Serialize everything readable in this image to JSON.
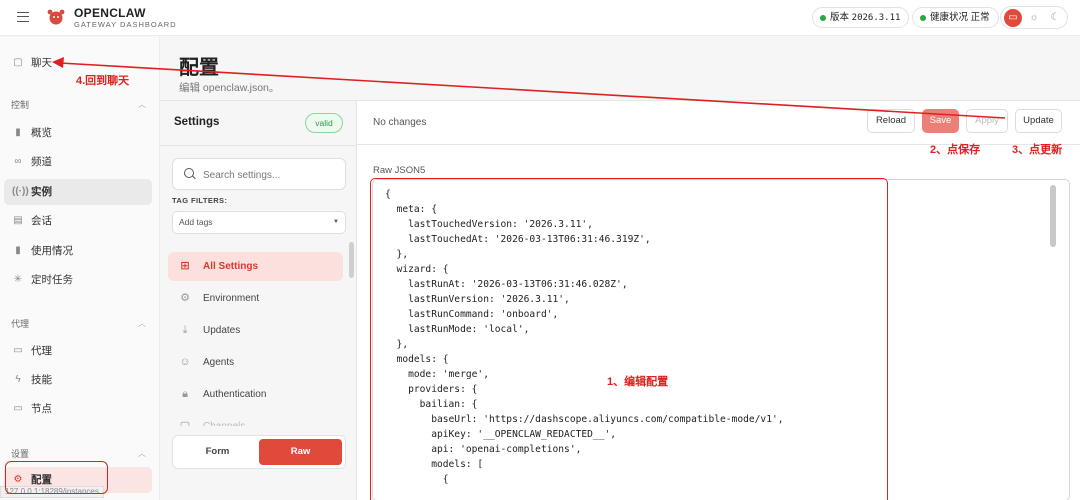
{
  "header": {
    "brand_title": "OPENCLAW",
    "brand_subtitle": "GATEWAY DASHBOARD",
    "version_label": "版本",
    "version_value": "2026.3.11",
    "health_label": "健康状况",
    "health_value": "正常"
  },
  "sidebar": {
    "chat": {
      "label": "聊天",
      "icon": "chat-bubble-icon"
    },
    "sections": [
      {
        "title": "控制",
        "items": [
          {
            "label": "概览",
            "icon": "bar-chart-icon"
          },
          {
            "label": "频道",
            "icon": "link-icon"
          },
          {
            "label": "实例",
            "icon": "broadcast-icon"
          },
          {
            "label": "会话",
            "icon": "document-icon"
          },
          {
            "label": "使用情况",
            "icon": "bar-chart-icon"
          },
          {
            "label": "定时任务",
            "icon": "loader-icon"
          }
        ]
      },
      {
        "title": "代理",
        "items": [
          {
            "label": "代理",
            "icon": "folder-icon"
          },
          {
            "label": "技能",
            "icon": "bolt-icon"
          },
          {
            "label": "节点",
            "icon": "monitor-icon"
          }
        ]
      },
      {
        "title": "设置",
        "items": [
          {
            "label": "配置",
            "icon": "gear-icon"
          }
        ]
      }
    ],
    "url_tip": "127.0.0.1:18289/instances"
  },
  "page": {
    "title": "配置",
    "subtitle": "编辑 openclaw.json。"
  },
  "settings": {
    "title": "Settings",
    "valid_badge": "valid",
    "search_placeholder": "Search settings...",
    "tag_filters_label": "TAG FILTERS:",
    "tag_select": "Add tags",
    "categories": [
      {
        "label": "All Settings",
        "icon": "grid-icon"
      },
      {
        "label": "Environment",
        "icon": "gear-icon"
      },
      {
        "label": "Updates",
        "icon": "download-icon"
      },
      {
        "label": "Agents",
        "icon": "robot-icon"
      },
      {
        "label": "Authentication",
        "icon": "lock-icon"
      },
      {
        "label": "Channels",
        "icon": "chat-bubble-icon"
      }
    ],
    "mode_form": "Form",
    "mode_raw": "Raw"
  },
  "toolbar": {
    "status": "No changes",
    "reload": "Reload",
    "save": "Save",
    "apply": "Apply",
    "update": "Update"
  },
  "editor": {
    "label": "Raw JSON5",
    "lines": [
      "{",
      "  meta: {",
      "    lastTouchedVersion: '2026.3.11',",
      "    lastTouchedAt: '2026-03-13T06:31:46.319Z',",
      "  },",
      "  wizard: {",
      "    lastRunAt: '2026-03-13T06:31:46.028Z',",
      "    lastRunVersion: '2026.3.11',",
      "    lastRunCommand: 'onboard',",
      "    lastRunMode: 'local',",
      "  },",
      "  models: {",
      "    mode: 'merge',",
      "    providers: {",
      "      bailian: {",
      "        baseUrl: 'https://dashscope.aliyuncs.com/compatible-mode/v1',",
      "        apiKey: '__OPENCLAW_REDACTED__',",
      "        api: 'openai-completions',",
      "        models: [",
      "          {"
    ]
  },
  "annotations": {
    "step1": "1、编辑配置",
    "step2": "2、点保存",
    "step3": "3、点更新",
    "step4": "4.回到聊天",
    "color": "#e02020"
  },
  "colors": {
    "accent": "#e04a3b",
    "status_ok": "#27a745"
  }
}
